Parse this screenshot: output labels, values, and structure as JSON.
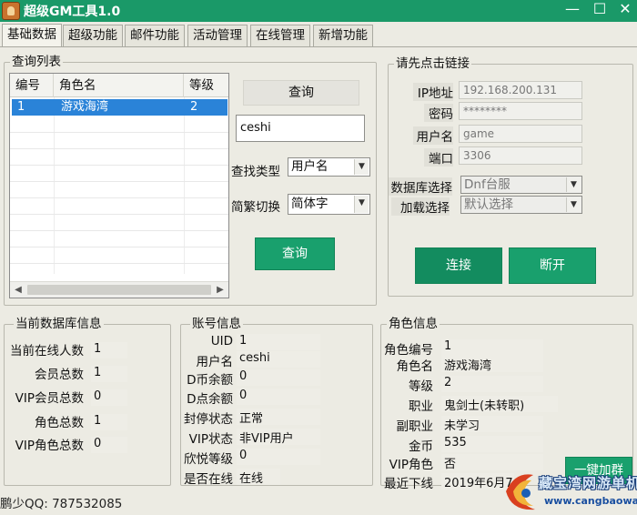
{
  "window": {
    "title": "超级GM工具1.0",
    "minimize": "—",
    "maximize": "☐",
    "close": "✕"
  },
  "tabs": [
    {
      "label": "基础数据",
      "active": true
    },
    {
      "label": "超级功能"
    },
    {
      "label": "邮件功能"
    },
    {
      "label": "活动管理"
    },
    {
      "label": "在线管理"
    },
    {
      "label": "新增功能"
    }
  ],
  "query": {
    "group_title": "查询列表",
    "columns": [
      "编号",
      "角色名",
      "等级"
    ],
    "rows": [
      {
        "id": "1",
        "name": "游戏海湾",
        "level": "2"
      }
    ],
    "top_button": "查询",
    "search_value": "ceshi",
    "search_type_label": "查找类型",
    "search_type_value": "用户名",
    "convert_label": "简繁切换",
    "convert_value": "简体字",
    "query_button": "查询"
  },
  "connection": {
    "group_title": "请先点击链接",
    "ip_label": "IP地址",
    "ip_value": "192.168.200.131",
    "password_label": "密码",
    "password_value": "********",
    "username_label": "用户名",
    "username_value": "game",
    "port_label": "端口",
    "port_value": "3306",
    "db_label": "数据库选择",
    "db_value": "Dnf台服",
    "load_label": "加载选择",
    "load_value": "默认选择",
    "connect_button": "连接",
    "disconnect_button": "断开"
  },
  "db_info": {
    "group_title": "当前数据库信息",
    "online_label": "当前在线人数",
    "online_value": "1",
    "members_label": "会员总数",
    "members_value": "1",
    "vip_members_label": "VIP会员总数",
    "vip_members_value": "0",
    "roles_label": "角色总数",
    "roles_value": "1",
    "vip_roles_label": "VIP角色总数",
    "vip_roles_value": "0"
  },
  "account": {
    "group_title": "账号信息",
    "uid_label": "UID",
    "uid_value": "1",
    "username_label": "用户名",
    "username_value": "ceshi",
    "dcoin_label": "D币余额",
    "dcoin_value": "0",
    "dpoint_label": "D点余额",
    "dpoint_value": "0",
    "ban_label": "封停状态",
    "ban_value": "正常",
    "vip_label": "VIP状态",
    "vip_value": "非VIP用户",
    "level_label": "欣悦等级",
    "level_value": "0",
    "online_label": "是否在线",
    "online_value": "在线"
  },
  "role": {
    "group_title": "角色信息",
    "id_label": "角色编号",
    "id_value": "1",
    "name_label": "角色名",
    "name_value": "游戏海湾",
    "level_label": "等级",
    "level_value": "2",
    "job_label": "职业",
    "job_value": "鬼剑士(未转职)",
    "subjob_label": "副职业",
    "subjob_value": "未学习",
    "gold_label": "金币",
    "gold_value": "535",
    "vip_label": "VIP角色",
    "vip_value": "否",
    "last_logout_label": "最近下线",
    "last_logout_value": "2019年6月7",
    "onekey_button": "一键加群"
  },
  "footer": {
    "qq_text": "鹏少QQ: 787532085"
  },
  "watermark": {
    "line1": "藏宝湾网游单机",
    "line2": "www.cangbaowan.net"
  }
}
